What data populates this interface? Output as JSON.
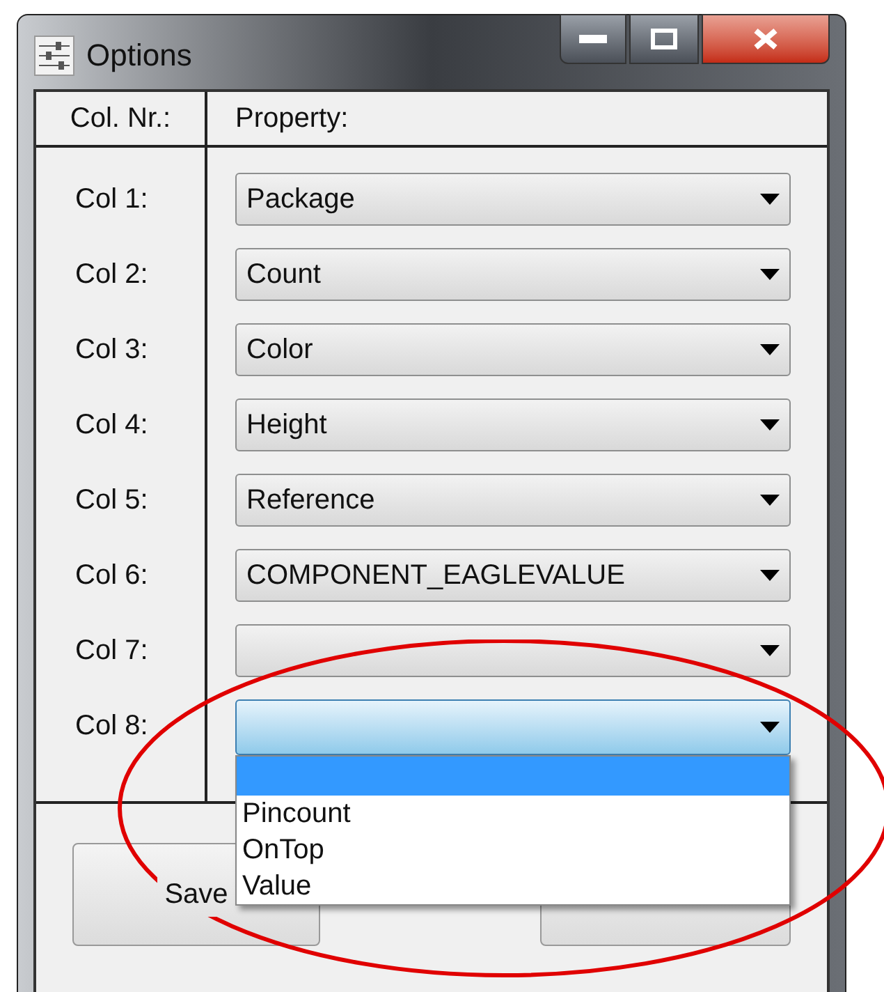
{
  "window": {
    "title": "Options"
  },
  "header": {
    "column_1": "Col. Nr.:",
    "column_2": "Property:"
  },
  "rows": [
    {
      "label": "Col 1:",
      "value": "Package",
      "expanded": false
    },
    {
      "label": "Col 2:",
      "value": "Count",
      "expanded": false
    },
    {
      "label": "Col 3:",
      "value": "Color",
      "expanded": false
    },
    {
      "label": "Col 4:",
      "value": "Height",
      "expanded": false
    },
    {
      "label": "Col 5:",
      "value": "Reference",
      "expanded": false
    },
    {
      "label": "Col 6:",
      "value": "COMPONENT_EAGLEVALUE",
      "expanded": false
    },
    {
      "label": "Col 7:",
      "expanded": false
    },
    {
      "label": "Col 8:",
      "expanded": true,
      "options": [
        {
          "selected": true
        },
        {
          "label": "Pincount",
          "selected": false
        },
        {
          "label": "OnTop",
          "selected": false
        },
        {
          "label": "Value",
          "selected": false
        }
      ]
    }
  ],
  "buttons": [
    {
      "label": "Save"
    }
  ]
}
